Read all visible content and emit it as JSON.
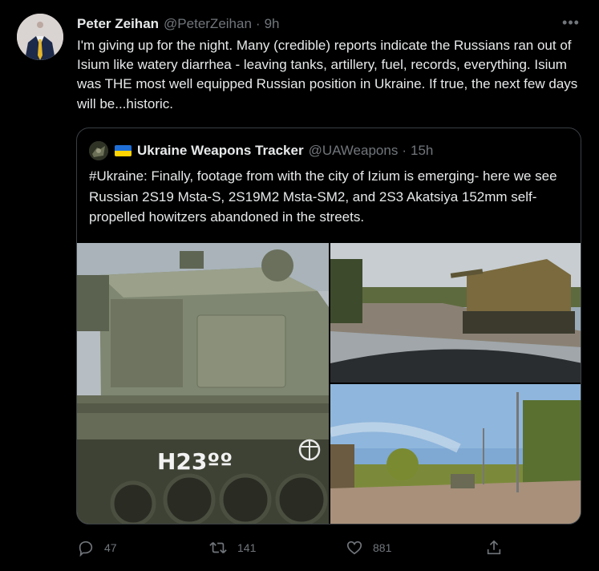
{
  "tweet": {
    "author_name": "Peter Zeihan",
    "author_handle": "@PeterZeihan",
    "separator": "·",
    "time": "9h",
    "text": "I'm giving up for the night. Many (credible) reports indicate the Russians ran out of Isium like watery diarrhea - leaving tanks, artillery, fuel, records, everything. Isium was THE most well equipped Russian position in Ukraine. If true, the next few days will be...historic.",
    "more_label": "•••"
  },
  "quote": {
    "author_name": "Ukraine Weapons Tracker",
    "author_handle": "@UAWeapons",
    "separator": "·",
    "time": "15h",
    "text": "#Ukraine: Finally, footage from with the city of Izium is emerging- here we see Russian 2S19 Msta-S, 2S19M2 Msta-SM2, and 2S3 Akatsiya 152mm self-propelled howitzers abandoned in the streets.",
    "hull_marking": "H23ºº",
    "flag_colors": [
      "#1f6fd6",
      "#ffd400"
    ]
  },
  "actions": {
    "reply_count": "47",
    "retweet_count": "141",
    "like_count": "881"
  },
  "colors": {
    "background": "#000000",
    "text": "#e7e9ea",
    "muted": "#71767b",
    "border": "#3a3f44"
  }
}
